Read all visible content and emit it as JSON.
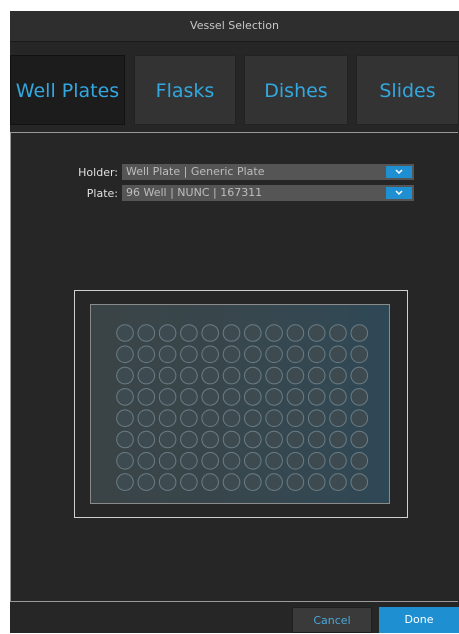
{
  "window": {
    "title": "Vessel Selection"
  },
  "tabs": [
    {
      "label": "Well Plates",
      "active": true
    },
    {
      "label": "Flasks",
      "active": false
    },
    {
      "label": "Dishes",
      "active": false
    },
    {
      "label": "Slides",
      "active": false
    }
  ],
  "form": {
    "holder": {
      "label": "Holder:",
      "value": "Well Plate | Generic Plate"
    },
    "plate": {
      "label": "Plate:",
      "value": "96 Well | NUNC | 167311"
    }
  },
  "plate_preview": {
    "rows": 8,
    "columns": 12
  },
  "buttons": {
    "cancel": "Cancel",
    "done": "Done"
  },
  "colors": {
    "accent": "#1e8fd0",
    "tab_text": "#33a8e0",
    "background": "#262626"
  }
}
